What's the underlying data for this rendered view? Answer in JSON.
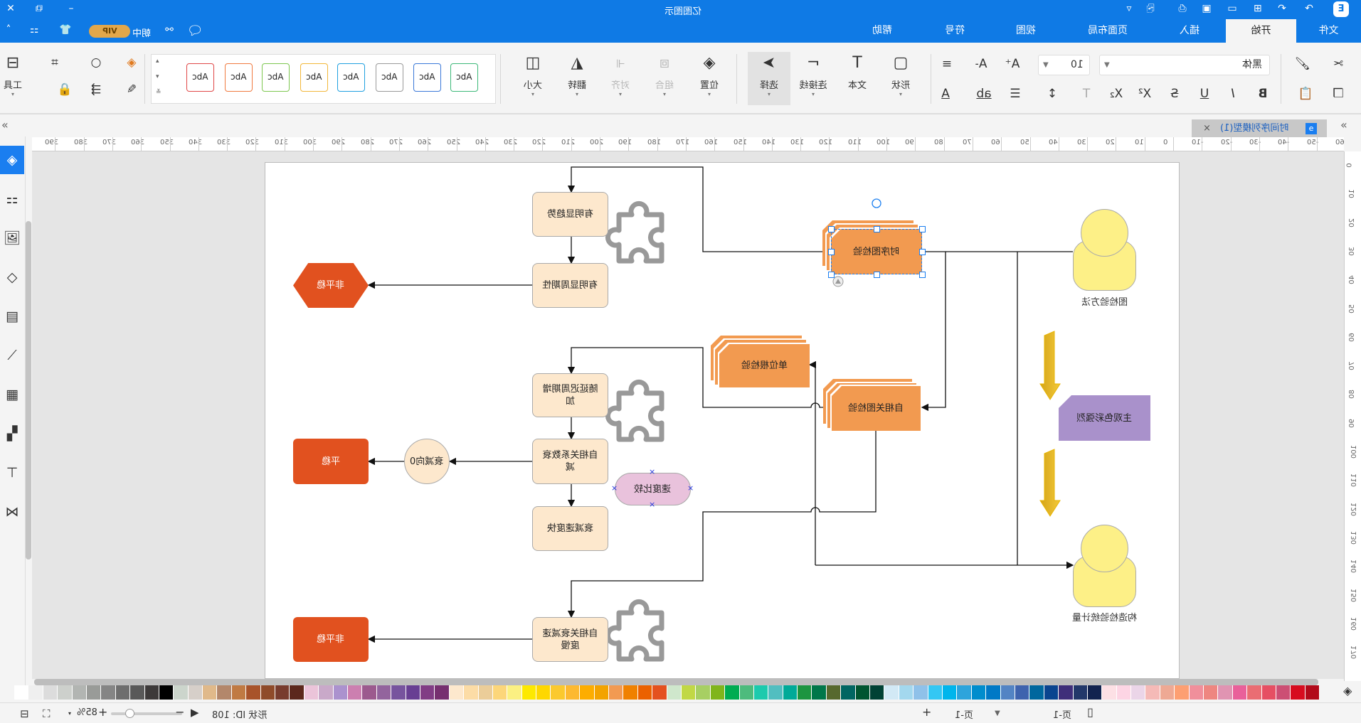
{
  "app": {
    "title": "亿图图示",
    "user_label": "朝中",
    "vip_label": "VIP"
  },
  "window_icons": [
    "close-icon",
    "restore-icon",
    "minimize-icon"
  ],
  "quick_access": [
    "customize-icon",
    "export-icon",
    "print-icon",
    "save-icon",
    "open-icon",
    "new-icon",
    "undo-icon",
    "redo-icon"
  ],
  "menu_tabs": [
    {
      "label": "文件"
    },
    {
      "label": "开始",
      "active": true
    },
    {
      "label": "插入"
    },
    {
      "label": "页面布局"
    },
    {
      "label": "视图"
    },
    {
      "label": "符号"
    },
    {
      "label": "帮助"
    }
  ],
  "ribbon": {
    "tools_label": "工具",
    "gallery": [
      {
        "label": "Abc",
        "color": "#e04848"
      },
      {
        "label": "Abc",
        "color": "#f07a40"
      },
      {
        "label": "Abc",
        "color": "#7dc750"
      },
      {
        "label": "Abc",
        "color": "#f2b73a"
      },
      {
        "label": "Abc",
        "color": "#20a0e0"
      },
      {
        "label": "Abc",
        "color": "#999999"
      },
      {
        "label": "Abc",
        "color": "#3a78d8"
      },
      {
        "label": "Abc",
        "color": "#3cb878"
      }
    ],
    "arrange": {
      "size": "大小",
      "flip": "翻转",
      "align": "对齐",
      "group": "组合",
      "position": "位置"
    },
    "insert": {
      "select": "选择",
      "connector": "连接线",
      "text": "文本",
      "shape": "形状"
    },
    "font": {
      "family": "黑体",
      "size": "10"
    }
  },
  "document_tab": {
    "title": "时间序列模型(1)"
  },
  "ruler": {
    "h_start": -60,
    "h_end": 400,
    "v_start": 0,
    "v_end": 170,
    "step": 10
  },
  "sidebar": [
    "format-icon",
    "symbols-icon",
    "image-icon",
    "layers-icon",
    "page-icon",
    "chart-icon",
    "table-icon",
    "puzzle-icon",
    "layout-icon",
    "mindmap-icon"
  ],
  "diagram": {
    "trend": "有明显趋势",
    "period": "有明显周期性",
    "nonstationary_1": "非平稳",
    "lag_increase": "随延迟周期增加",
    "acf_decay": "自相关系数衰减",
    "decay_fast": "衰减速度快",
    "decay_to_zero": "衰减向0",
    "stationary": "平稳",
    "acf_slow": "自相关衰减速度慢",
    "nonstationary_2": "非平稳",
    "speed_compare": "速度比较",
    "timeseries_test": "时序图检验",
    "unit_root_test": "单位根检验",
    "acf_plot_test": "自相关图检验",
    "method": "图检验方法",
    "subjective": "主观色彩强烈",
    "statistic": "构造检验统计量"
  },
  "palette": [
    "#ffffff",
    "#efefef",
    "#dcdcdc",
    "#cdd0cc",
    "#b2b5b2",
    "#999b98",
    "#858585",
    "#6e6e6e",
    "#595959",
    "#3d3a3a",
    "#000000",
    "#ccd5cc",
    "#d6cfc9",
    "#e0b98a",
    "#b3876b",
    "#c07a43",
    "#a8532a",
    "#8f4b2a",
    "#783c2e",
    "#5c281c",
    "#ebc4d9",
    "#c9a9c9",
    "#ab92ce",
    "#cc7fb0",
    "#9c5a8e",
    "#93649d",
    "#77549e",
    "#683f93",
    "#813d85",
    "#763070",
    "#fde8cd",
    "#fcdca6",
    "#ebcd99",
    "#fcd67a",
    "#fbf082",
    "#fde900",
    "#fed700",
    "#fbc92e",
    "#fdb930",
    "#fdad00",
    "#f3a300",
    "#f29a52",
    "#f08100",
    "#eb6100",
    "#e4511f",
    "#cfe7cc",
    "#c1d845",
    "#a7cf63",
    "#80b51c",
    "#00ac51",
    "#4dbb7d",
    "#1ccaad",
    "#52bec0",
    "#00aa98",
    "#1c9540",
    "#00774a",
    "#57692e",
    "#006662",
    "#005530",
    "#004235",
    "#d2e9f5",
    "#a3d8ee",
    "#8fc1e9",
    "#34c7f3",
    "#00b5ec",
    "#2da4dc",
    "#008dcd",
    "#0079c6",
    "#5384c4",
    "#3e63ae",
    "#00679e",
    "#0a448f",
    "#3f2f7a",
    "#22386a",
    "#12234f",
    "#fde0e5",
    "#fdd5e4",
    "#ebd5e8",
    "#f5bab7",
    "#eea994",
    "#fd9f72",
    "#f08f9b",
    "#ee8680",
    "#e094b2",
    "#e9609a",
    "#ea6d73",
    "#e64f63",
    "#cc4f74",
    "#d70c1f",
    "#b20a1a"
  ],
  "status": {
    "shape_id": "形状 ID: 108",
    "zoom": "85%",
    "zoom_level_percent": 85,
    "page_current": "页-1",
    "page_tab": "页-1"
  }
}
